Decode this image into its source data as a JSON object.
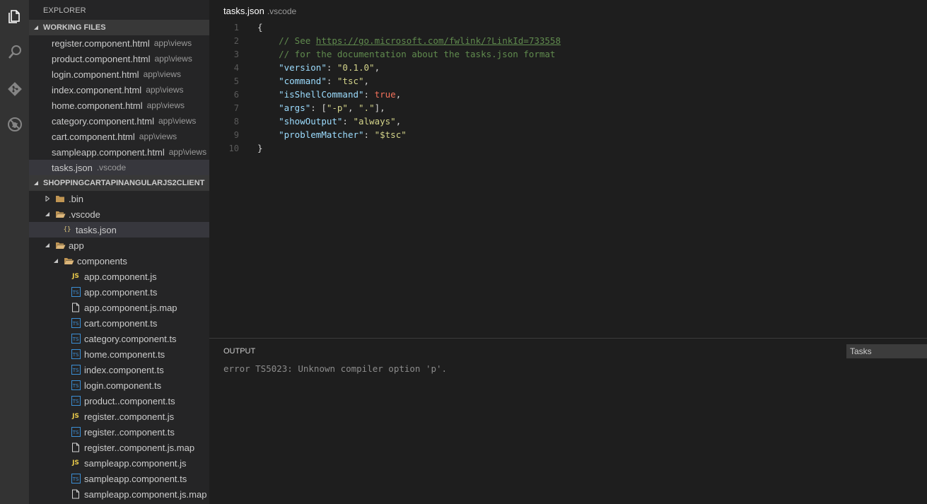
{
  "explorer": {
    "title": "EXPLORER",
    "working_files_header": "WORKING FILES",
    "working_files": [
      {
        "name": "register.component.html",
        "desc": "app\\views"
      },
      {
        "name": "product.component.html",
        "desc": "app\\views"
      },
      {
        "name": "login.component.html",
        "desc": "app\\views"
      },
      {
        "name": "index.component.html",
        "desc": "app\\views"
      },
      {
        "name": "home.component.html",
        "desc": "app\\views"
      },
      {
        "name": "category.component.html",
        "desc": "app\\views"
      },
      {
        "name": "cart.component.html",
        "desc": "app\\views"
      },
      {
        "name": "sampleapp.component.html",
        "desc": "app\\views"
      },
      {
        "name": "tasks.json",
        "desc": ".vscode"
      }
    ],
    "project_header": "SHOPPINGCARTAPINANGULARJS2CLIENT",
    "tree": [
      {
        "label": ".bin",
        "kind": "folder-collapsed"
      },
      {
        "label": ".vscode",
        "kind": "folder-open"
      },
      {
        "label": "tasks.json",
        "kind": "json"
      },
      {
        "label": "app",
        "kind": "folder-open"
      },
      {
        "label": "components",
        "kind": "folder-open"
      },
      {
        "label": "app.component.js",
        "kind": "js"
      },
      {
        "label": "app.component.ts",
        "kind": "ts"
      },
      {
        "label": "app.component.js.map",
        "kind": "file"
      },
      {
        "label": "cart.component.ts",
        "kind": "ts"
      },
      {
        "label": "category.component.ts",
        "kind": "ts"
      },
      {
        "label": "home.component.ts",
        "kind": "ts"
      },
      {
        "label": "index.component.ts",
        "kind": "ts"
      },
      {
        "label": "login.component.ts",
        "kind": "ts"
      },
      {
        "label": "product..component.ts",
        "kind": "ts"
      },
      {
        "label": "register..component.js",
        "kind": "js"
      },
      {
        "label": "register..component.ts",
        "kind": "ts"
      },
      {
        "label": "register..component.js.map",
        "kind": "file"
      },
      {
        "label": "sampleapp.component.js",
        "kind": "js"
      },
      {
        "label": "sampleapp.component.ts",
        "kind": "ts"
      },
      {
        "label": "sampleapp.component.js.map",
        "kind": "file"
      }
    ]
  },
  "editor": {
    "file_name": "tasks.json",
    "file_desc": ".vscode",
    "line_numbers": [
      "1",
      "2",
      "3",
      "4",
      "5",
      "6",
      "7",
      "8",
      "9",
      "10"
    ],
    "lines": {
      "l1": "{",
      "l2_comment": "    // See ",
      "l2_link": "https://go.microsoft.com/fwlink/?LinkId=733558",
      "l3_comment": "    // for the documentation about the tasks.json format",
      "l4_key": "\"version\"",
      "l4_val": "\"0.1.0\"",
      "l5_key": "\"command\"",
      "l5_val": "\"tsc\"",
      "l6_key": "\"isShellCommand\"",
      "l6_val": "true",
      "l7_key": "\"args\"",
      "l7_v1": "\"-p\"",
      "l7_v2": "\".\"",
      "l8_key": "\"showOutput\"",
      "l8_val": "\"always\"",
      "l9_key": "\"problemMatcher\"",
      "l9_val": "\"$tsc\"",
      "l10": "}"
    }
  },
  "output": {
    "title": "OUTPUT",
    "channel": "Tasks",
    "text": "error TS5023: Unknown compiler option 'p'."
  },
  "colors": {
    "activity_bar": "#333333",
    "sidebar": "#252526",
    "editor_bg": "#1e1e1e",
    "section_header": "#383838"
  }
}
